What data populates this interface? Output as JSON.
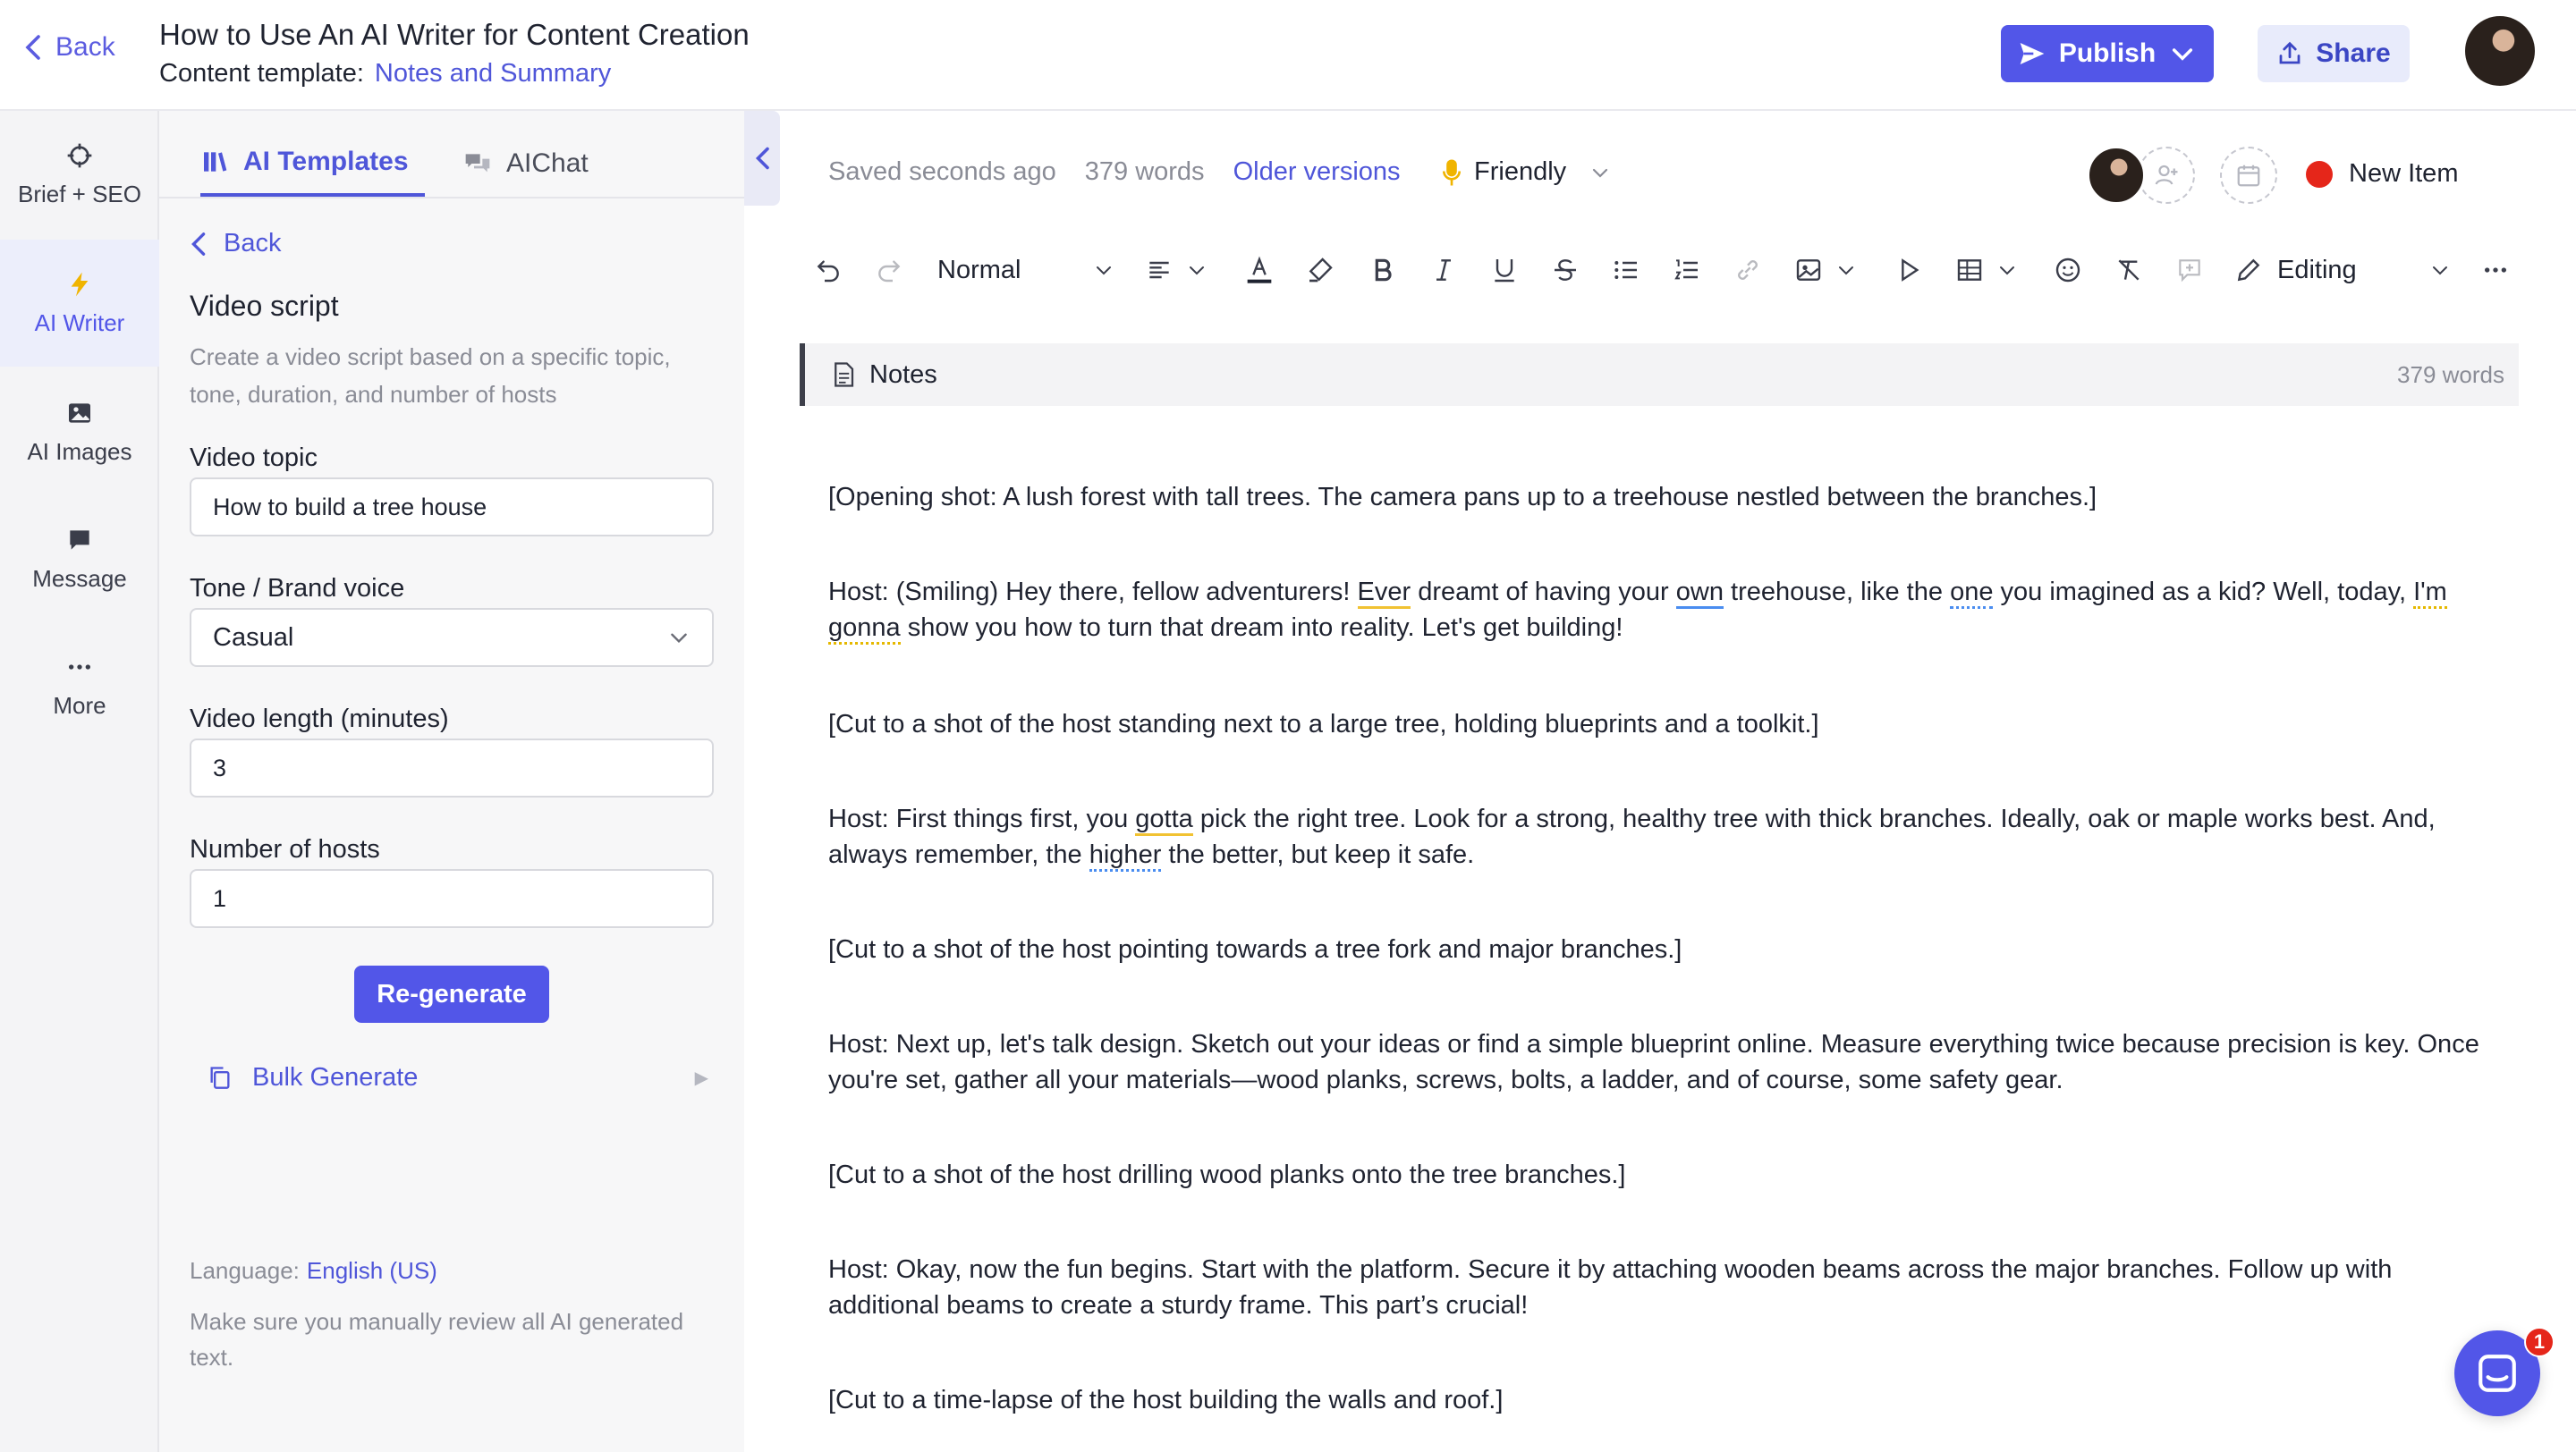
{
  "header": {
    "back_label": "Back",
    "title": "How to Use An AI Writer for Content Creation",
    "template_label": "Content template:",
    "template_name": "Notes and Summary",
    "publish_label": "Publish",
    "share_label": "Share"
  },
  "rail": {
    "items": [
      {
        "label": "Brief + SEO",
        "icon": "crosshair-icon"
      },
      {
        "label": "AI Writer",
        "icon": "lightning-icon"
      },
      {
        "label": "AI Images",
        "icon": "image-icon"
      },
      {
        "label": "Message",
        "icon": "message-icon"
      },
      {
        "label": "More",
        "icon": "more-icon"
      }
    ]
  },
  "panel": {
    "tabs": [
      {
        "label": "AI Templates",
        "icon": "library-icon"
      },
      {
        "label": "AIChat",
        "icon": "chat-icon"
      }
    ],
    "back_label": "Back",
    "section_title": "Video script",
    "section_desc": "Create a video script based on a specific topic, tone, duration, and number of hosts",
    "fields": {
      "topic": {
        "label": "Video topic",
        "value": "How to build a tree house"
      },
      "tone": {
        "label": "Tone / Brand voice",
        "value": "Casual"
      },
      "length": {
        "label": "Video length (minutes)",
        "value": "3"
      },
      "hosts": {
        "label": "Number of hosts",
        "value": "1"
      }
    },
    "regenerate_label": "Re-generate",
    "bulk_label": "Bulk Generate",
    "language_label": "Language:",
    "language_value": "English (US)",
    "review_note": "Make sure you manually review all AI generated text."
  },
  "editor": {
    "saved": "Saved seconds ago",
    "word_count": "379 words",
    "older_versions": "Older versions",
    "tone": "Friendly",
    "status": "New Item",
    "status_color": "#e5261a",
    "toolbar": {
      "style": "Normal",
      "mode": "Editing"
    },
    "notes_label": "Notes",
    "notes_words": "379 words"
  },
  "document": {
    "p1": "[Opening shot: A lush forest with tall trees. The camera pans up to a treehouse nestled between the branches.]",
    "p2": [
      "Host: (Smiling) Hey there, fellow adventurers! ",
      "Ever",
      " dreamt of having your ",
      "own",
      " treehouse, like the ",
      "one",
      " you imagined as a kid? Well, today, ",
      "I'm gonna",
      " show you how to turn that dream into reality. Let's get building!"
    ],
    "p3": "[Cut to a shot of the host standing next to a large tree, holding blueprints and a toolkit.]",
    "p4": [
      "Host: First things first, you ",
      "gotta",
      " pick the right tree. Look for a strong, healthy tree with thick branches. Ideally, oak or maple works best. And, always remember, the ",
      "higher",
      " the better, but keep it safe."
    ],
    "p5": "[Cut to a shot of the host pointing towards a tree fork and major branches.]",
    "p6": "Host: Next up, let's talk design. Sketch out your ideas or find a simple blueprint online. Measure everything twice because precision is key. Once you're set, gather all your materials—wood planks, screws, bolts, a ladder, and of course, some safety gear.",
    "p7": "[Cut to a shot of the host drilling wood planks onto the tree branches.]",
    "p8": "Host: Okay, now the fun begins. Start with the platform. Secure it by attaching wooden beams across the major branches. Follow up with additional beams to create a sturdy frame. This part’s crucial!",
    "p9": "[Cut to a time-lapse of the host building the walls and roof.]"
  },
  "chat_badge": "1",
  "colors": {
    "accent": "#5256e8",
    "link": "#4f56d9"
  }
}
